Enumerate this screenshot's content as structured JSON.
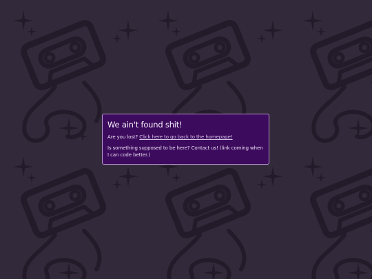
{
  "background": {
    "base_color": "#322a3a",
    "motif_color": "#241b2a",
    "motifs": [
      "cassette-tape-icon",
      "sparkle-icon"
    ]
  },
  "notice": {
    "heading": "We ain't found shit!",
    "lost_prefix": "Are you lost? ",
    "home_link_label": "Click here to go back to the homepage!",
    "contact_text": "Is something supposed to be here? Contact us! (link coming when I can code better.)",
    "box_color": "#3d0b5e",
    "border_color": "#b59ad2"
  }
}
